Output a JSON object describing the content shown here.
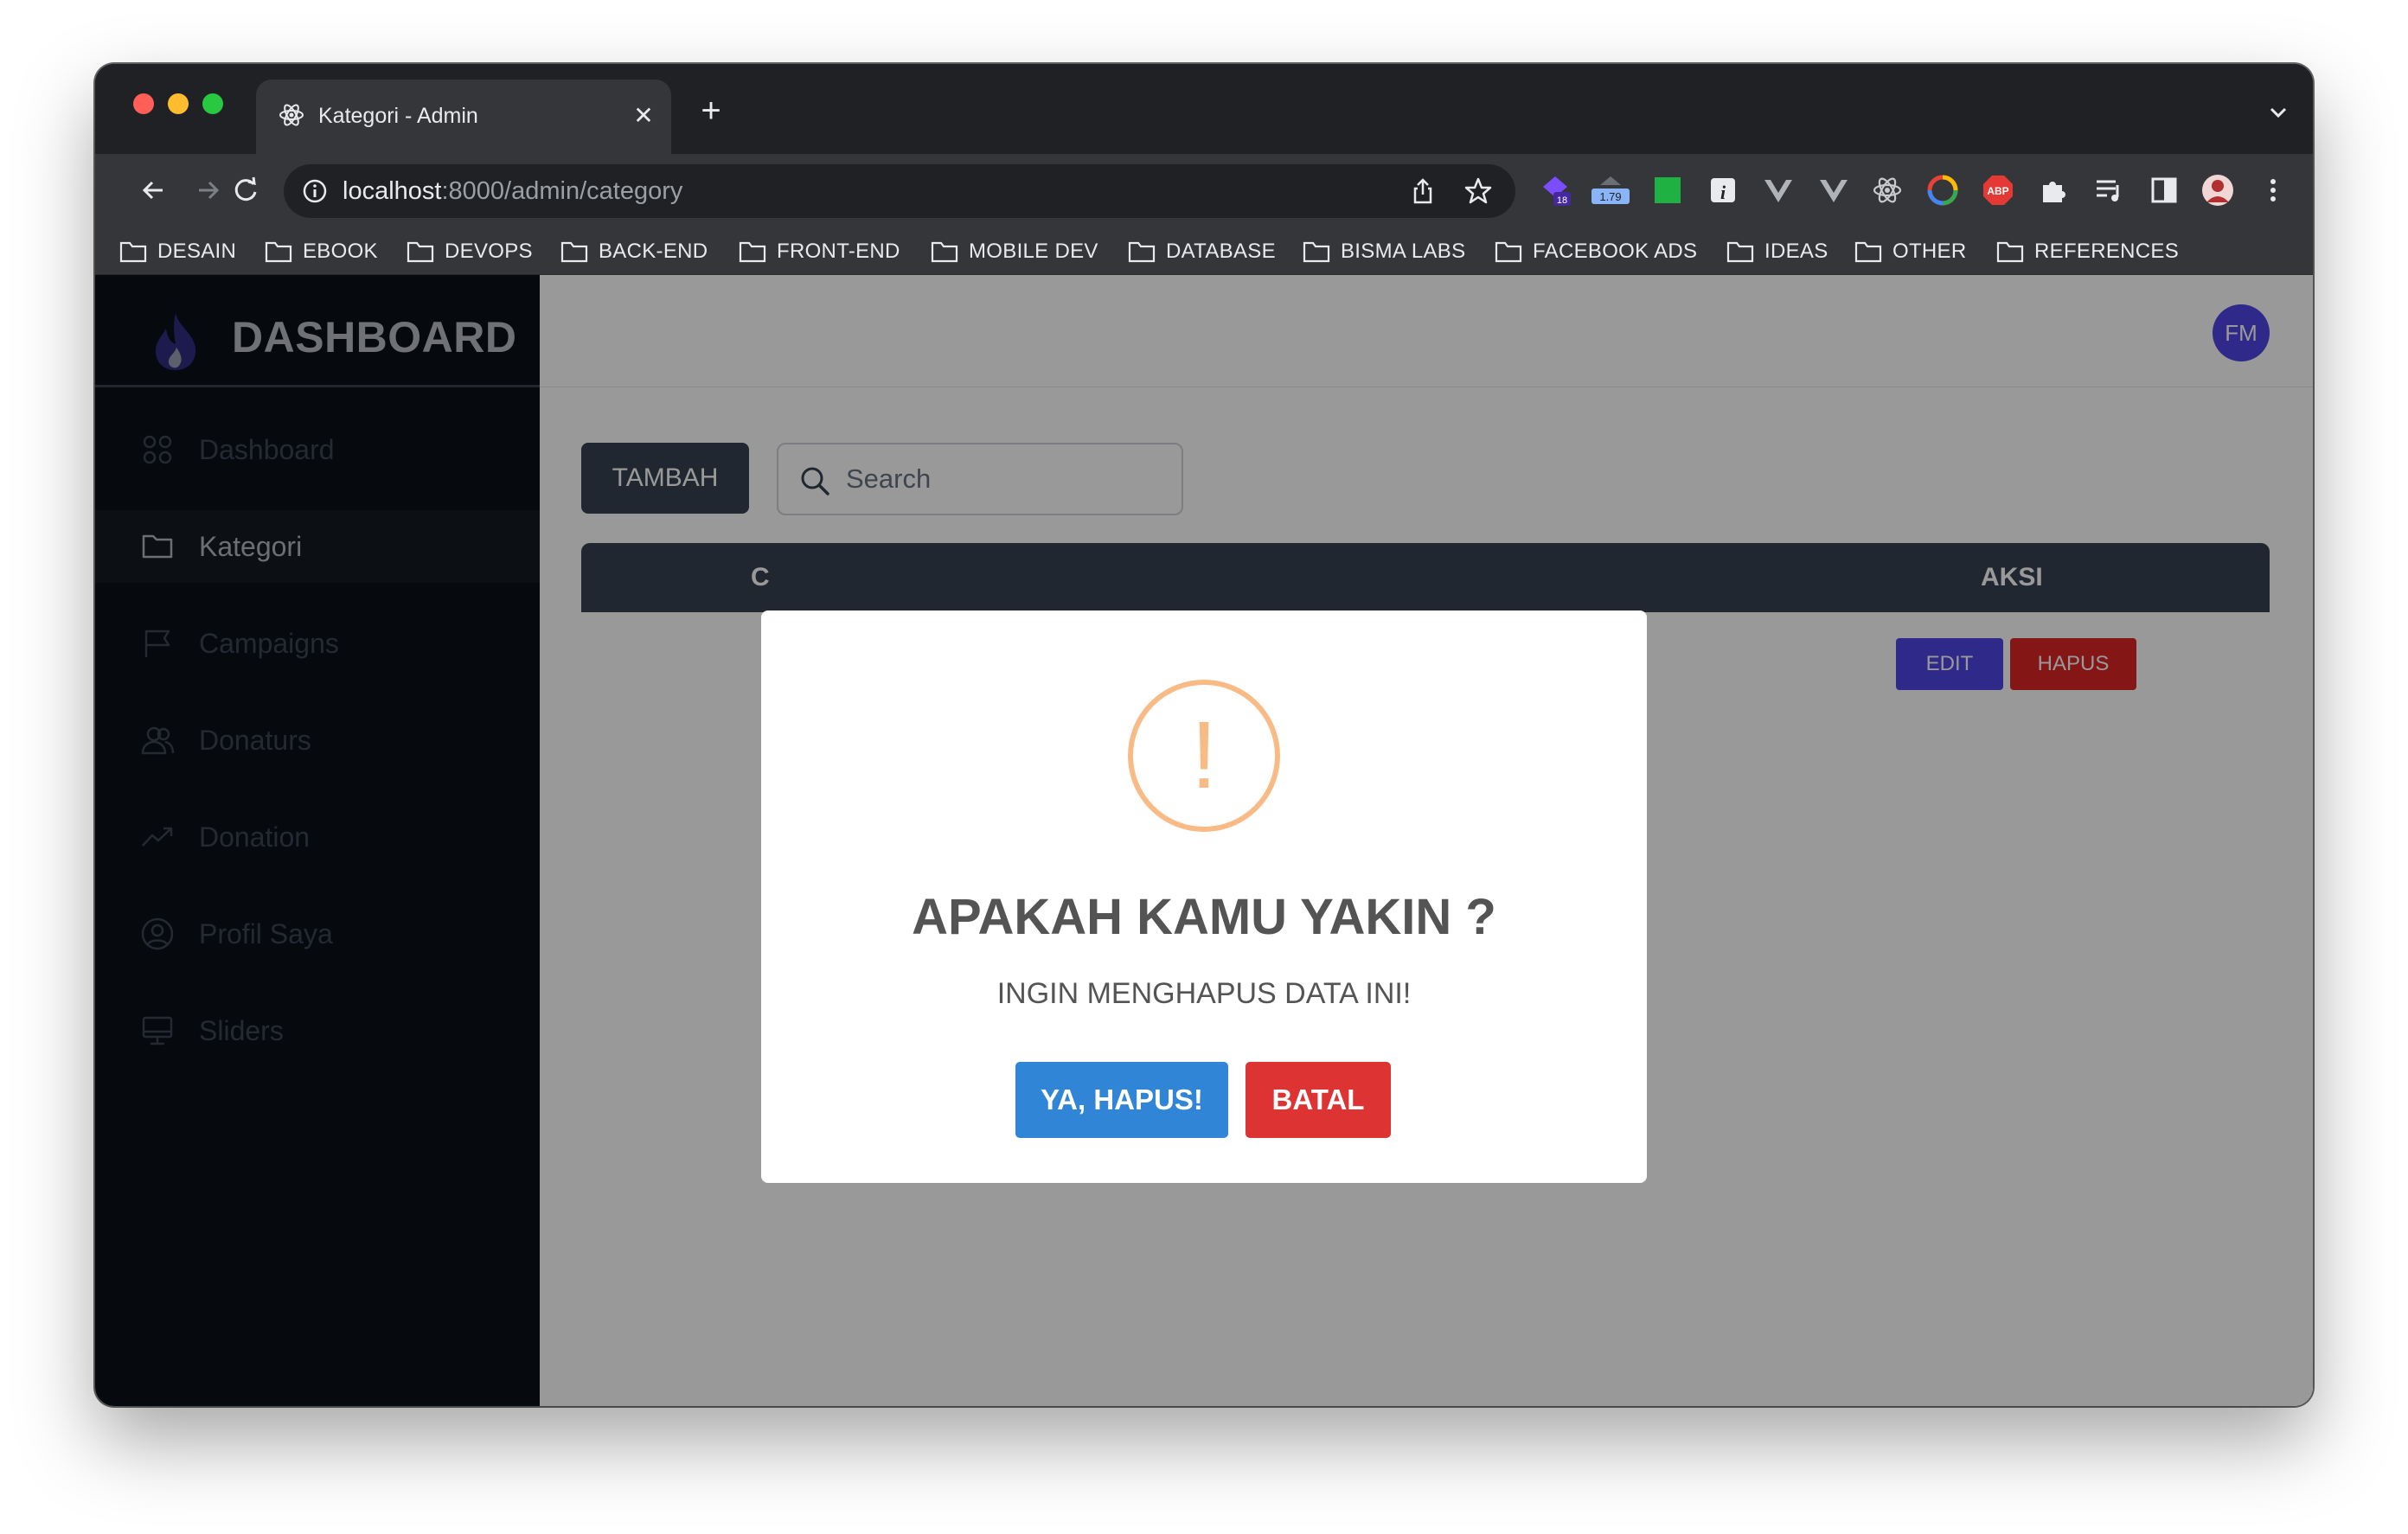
{
  "browser": {
    "tab_title": "Kategori - Admin",
    "url_host": "localhost",
    "url_path": ":8000/admin/category",
    "extension_badges": {
      "badge_a": "18",
      "badge_b": "1.79",
      "abp": "ABP"
    },
    "bookmarks": [
      "DESAIN",
      "EBOOK",
      "DEVOPS",
      "BACK-END",
      "FRONT-END",
      "MOBILE DEV",
      "DATABASE",
      "BISMA LABS",
      "FACEBOOK ADS",
      "IDEAS",
      "OTHER",
      "REFERENCES"
    ]
  },
  "sidebar": {
    "title": "DASHBOARD",
    "items": [
      {
        "label": "Dashboard",
        "icon": "grid-icon"
      },
      {
        "label": "Kategori",
        "icon": "folder-icon",
        "active": true
      },
      {
        "label": "Campaigns",
        "icon": "flag-icon"
      },
      {
        "label": "Donaturs",
        "icon": "users-icon"
      },
      {
        "label": "Donation",
        "icon": "trending-up-icon"
      },
      {
        "label": "Profil Saya",
        "icon": "user-circle-icon"
      },
      {
        "label": "Sliders",
        "icon": "monitor-icon"
      }
    ]
  },
  "header": {
    "avatar_initials": "FM"
  },
  "toolbar": {
    "add_label": "TAMBAH",
    "search_placeholder": "Search"
  },
  "table": {
    "header_partial": "C",
    "action_header": "AKSI",
    "row_actions": {
      "edit": "EDIT",
      "delete": "HAPUS"
    }
  },
  "modal": {
    "icon_glyph": "!",
    "title": "APAKAH KAMU YAKIN ?",
    "text": "INGIN MENGHAPUS DATA INI!",
    "confirm_label": "YA, HAPUS!",
    "cancel_label": "BATAL"
  },
  "colors": {
    "sidebar_bg": "#0b0f17",
    "primary_dark": "#374151",
    "indigo": "#4f46e5",
    "danger": "#dc2626",
    "confirm_blue": "#3085d6",
    "cancel_red": "#dd3333",
    "warning": "#f8bb86"
  }
}
